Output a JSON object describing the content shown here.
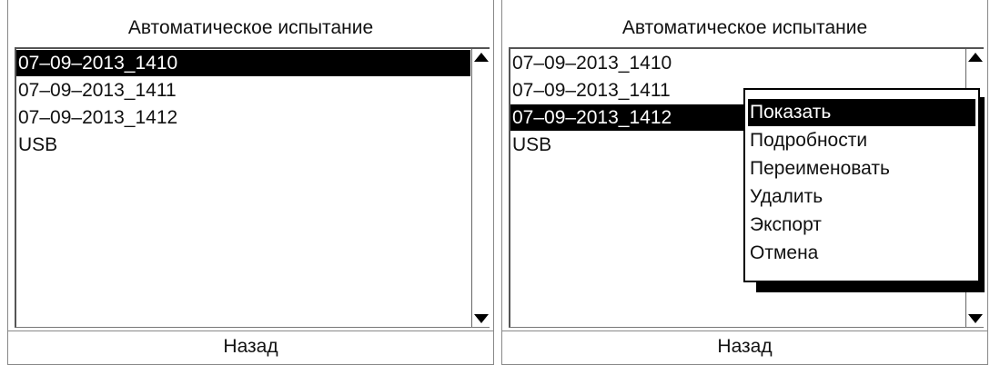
{
  "left_screen": {
    "title": "Автоматическое испытание",
    "items": [
      "07–09–2013_1410",
      "07–09–2013_1411",
      "07–09–2013_1412",
      "USB"
    ],
    "selected_index": 0,
    "footer": "Назад"
  },
  "right_screen": {
    "title": "Автоматическое испытание",
    "items": [
      "07–09–2013_1410",
      "07–09–2013_1411",
      "07–09–2013_1412",
      "USB"
    ],
    "selected_index": 2,
    "footer": "Назад",
    "context_menu": {
      "items": [
        "Показать",
        "Подробности",
        "Переименовать",
        "Удалить",
        "Экспорт",
        "Отмена"
      ],
      "highlighted_index": 0
    }
  },
  "icons": {
    "scroll_up": "triangle-up-icon",
    "scroll_down": "triangle-down-icon"
  }
}
